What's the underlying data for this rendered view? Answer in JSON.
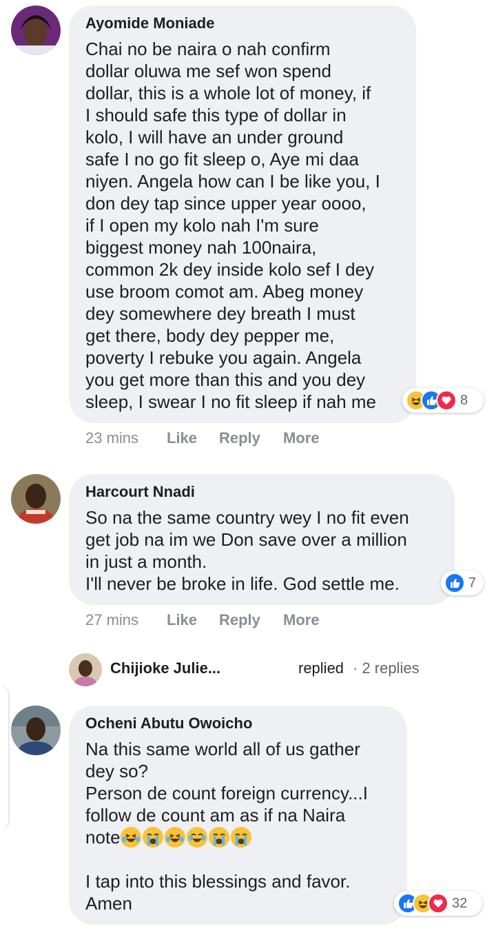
{
  "comments": [
    {
      "author": "Ayomide Moniade",
      "text": "Chai no be naira o nah confirm\ndollar oluwa me sef won spend\ndollar, this is a whole lot of money, if\nI should safe this type of dollar in\nkolo, I will have an under ground\nsafe I no go fit sleep o, Aye mi daa\nniyen. Angela how can I be like you, I\ndon dey tap since upper year oooo,\nif I open my kolo nah I'm sure\nbiggest money nah 100naira,\ncommon 2k dey inside kolo sef I dey\nuse broom comot am. Abeg money\ndey somewhere dey breath I must\nget there, body dey pepper me,\npoverty I rebuke you again. Angela\nyou get more than this and you dey\nsleep, I swear I no fit sleep if nah me",
      "reactions_count": "8",
      "time": "23 mins",
      "like_label": "Like",
      "reply_label": "Reply",
      "more_label": "More"
    },
    {
      "author": "Harcourt Nnadi",
      "text": "So na the same country wey I no fit even\nget job na im we Don save over a million\nin just a month.\nI'll never be broke in life. God settle me.",
      "reactions_count": "7",
      "time": "27 mins",
      "like_label": "Like",
      "reply_label": "Reply",
      "more_label": "More"
    },
    {
      "author": "Ocheni Abutu Owoicho",
      "text_line1": "Na this same world all of us gather\ndey so?\nPerson de count foreign currency...I\nfollow de count am as if na Naira\nnote",
      "text_line2": "I tap into this blessings and favor.\nAmen",
      "reactions_count": "32"
    }
  ],
  "reply_summary": {
    "name": "Chijioke Julie...",
    "verb": "replied",
    "count": "· 2 replies"
  },
  "colors": {
    "bubble": "#eef0f3",
    "like": "#1877f2",
    "love": "#f02849",
    "haha": "#f7c33b",
    "meta": "#8a8d91"
  }
}
